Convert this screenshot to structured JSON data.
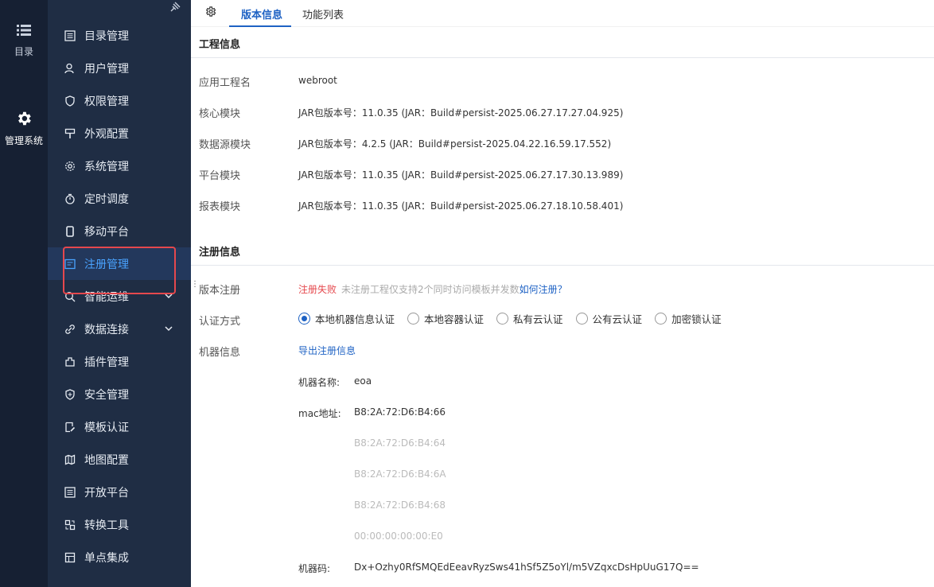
{
  "rail": {
    "catalog_label": "目录",
    "system_label": "管理系统"
  },
  "menu": {
    "items": [
      {
        "label": "目录管理",
        "icon": "list-icon"
      },
      {
        "label": "用户管理",
        "icon": "user-icon"
      },
      {
        "label": "权限管理",
        "icon": "shield-icon"
      },
      {
        "label": "外观配置",
        "icon": "paint-icon"
      },
      {
        "label": "系统管理",
        "icon": "gear-icon"
      },
      {
        "label": "定时调度",
        "icon": "timer-icon"
      },
      {
        "label": "移动平台",
        "icon": "mobile-icon"
      },
      {
        "label": "注册管理",
        "icon": "register-icon",
        "active": true
      },
      {
        "label": "智能运维",
        "icon": "search-icon"
      },
      {
        "label": "数据连接",
        "icon": "link-icon"
      },
      {
        "label": "插件管理",
        "icon": "plugin-icon"
      },
      {
        "label": "安全管理",
        "icon": "security-icon"
      },
      {
        "label": "模板认证",
        "icon": "template-icon"
      },
      {
        "label": "地图配置",
        "icon": "map-icon"
      },
      {
        "label": "开放平台",
        "icon": "list-icon"
      },
      {
        "label": "转换工具",
        "icon": "convert-icon"
      },
      {
        "label": "单点集成",
        "icon": "sso-icon"
      }
    ],
    "active_color": "#4aa3ff"
  },
  "tabs": [
    {
      "label": "版本信息",
      "active": true
    },
    {
      "label": "功能列表"
    }
  ],
  "project": {
    "title": "工程信息",
    "rows": [
      {
        "label": "应用工程名",
        "value": "webroot"
      },
      {
        "label": "核心模块",
        "value": "JAR包版本号：11.0.35 (JAR：Build#persist-2025.06.27.17.27.04.925)"
      },
      {
        "label": "数据源模块",
        "value": "JAR包版本号：4.2.5 (JAR：Build#persist-2025.04.22.16.59.17.552)"
      },
      {
        "label": "平台模块",
        "value": "JAR包版本号：11.0.35 (JAR：Build#persist-2025.06.27.17.30.13.989)"
      },
      {
        "label": "报表模块",
        "value": "JAR包版本号：11.0.35 (JAR：Build#persist-2025.06.27.18.10.58.401)"
      }
    ]
  },
  "registration": {
    "title": "注册信息",
    "version_label": "版本注册",
    "status": "注册失败",
    "hint": "未注册工程仅支持2个同时访问模板并发数",
    "how_link": "如何注册？",
    "auth_label": "认证方式",
    "auth_options": [
      "本地机器信息认证",
      "本地容器认证",
      "私有云认证",
      "公有云认证",
      "加密锁认证"
    ],
    "auth_selected": 0,
    "machine_label": "机器信息",
    "export_link": "导出注册信息",
    "machine_name_key": "机器名称:",
    "machine_name": "eoa",
    "mac_key": "mac地址:",
    "macs": [
      "B8:2A:72:D6:B4:66",
      "B8:2A:72:D6:B4:64",
      "B8:2A:72:D6:B4:6A",
      "B8:2A:72:D6:B4:68",
      "00:00:00:00:00:E0"
    ],
    "code_key": "机器码:",
    "code": "Dx+Ozhy0RfSMQEdEeavRyzSws41hSf5Z5oYl/m5VZqxcDsHpUuG17Q=="
  },
  "colors": {
    "rail_bg": "#162033",
    "menu_bg": "#1f2d44",
    "accent": "#1e62c4",
    "error": "#e5484d"
  }
}
